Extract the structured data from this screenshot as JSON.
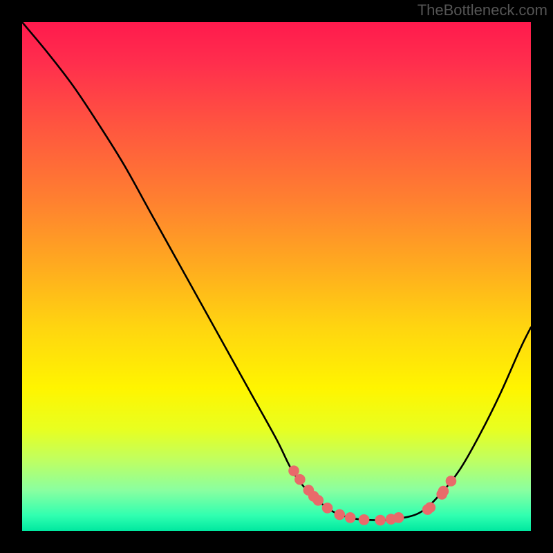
{
  "watermark": "TheBottleneck.com",
  "chart_data": {
    "type": "line",
    "title": "",
    "xlabel": "",
    "ylabel": "",
    "xlim": [
      0,
      100
    ],
    "ylim": [
      0,
      100
    ],
    "series": [
      {
        "name": "curve",
        "x": [
          0,
          5,
          10,
          15,
          20,
          25,
          30,
          35,
          40,
          45,
          50,
          53,
          56,
          60,
          63,
          66,
          70,
          73,
          78,
          82,
          86,
          90,
          94,
          98,
          100
        ],
        "y": [
          100,
          94,
          87.5,
          80,
          72,
          63,
          54,
          45,
          36,
          27,
          18,
          12,
          8,
          4.5,
          3,
          2.3,
          2.1,
          2.3,
          3.5,
          7,
          12,
          19,
          27,
          36,
          40
        ]
      }
    ],
    "points": {
      "name": "dots",
      "color": "#e96a6a",
      "x": [
        53.4,
        54.6,
        56.3,
        57.3,
        58.2,
        60.0,
        62.4,
        64.5,
        67.2,
        70.4,
        72.5,
        74.0,
        79.7,
        80.2,
        82.5,
        82.8,
        84.3
      ],
      "y": [
        11.8,
        10.1,
        8.0,
        6.8,
        6.0,
        4.5,
        3.2,
        2.6,
        2.2,
        2.1,
        2.3,
        2.6,
        4.2,
        4.6,
        7.2,
        7.8,
        9.8
      ]
    }
  }
}
